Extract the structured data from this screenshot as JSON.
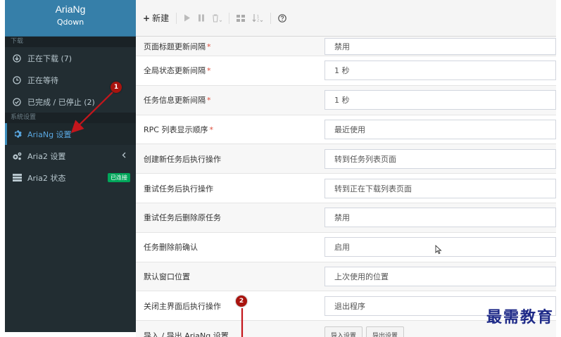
{
  "brand": {
    "title": "AriaNg",
    "subtitle": "Qdown"
  },
  "sidebar": {
    "section_download": "下载",
    "downloading": "正在下载 (7)",
    "waiting": "正在等待",
    "stopped": "已完成 / 已停止 (2)",
    "section_settings": "系统设置",
    "ariang_settings": "AriaNg 设置",
    "aria2_settings": "Aria2 设置",
    "aria2_status": "Aria2 状态",
    "connected_badge": "已连接"
  },
  "toolbar": {
    "new_label": "新建"
  },
  "settings": [
    {
      "label": "页面标题更新间隔",
      "required": "*",
      "value": "禁用"
    },
    {
      "label": "全局状态更新间隔",
      "required": "*",
      "value": "1 秒"
    },
    {
      "label": "任务信息更新间隔",
      "required": "*",
      "value": "1 秒"
    },
    {
      "label": "RPC 列表显示顺序",
      "required": "*",
      "value": "最近使用"
    },
    {
      "label": "创建新任务后执行操作",
      "required": "",
      "value": "转到任务列表页面"
    },
    {
      "label": "重试任务后执行操作",
      "required": "",
      "value": "转到正在下载列表页面"
    },
    {
      "label": "重试任务后删除原任务",
      "required": "",
      "value": "禁用"
    },
    {
      "label": "任务删除前确认",
      "required": "",
      "value": "启用"
    },
    {
      "label": "默认窗口位置",
      "required": "",
      "value": "上次使用的位置"
    },
    {
      "label": "关闭主界面后执行操作",
      "required": "",
      "value": "退出程序"
    },
    {
      "label": "导入 / 导出 AriaNg 设置",
      "required": ""
    }
  ],
  "import_export": {
    "import_label": "导入设置",
    "export_label": "导出设置"
  },
  "annotations": {
    "marker1": "1",
    "marker2": "2",
    "color": "#a9140f"
  },
  "watermark": "最需教育"
}
